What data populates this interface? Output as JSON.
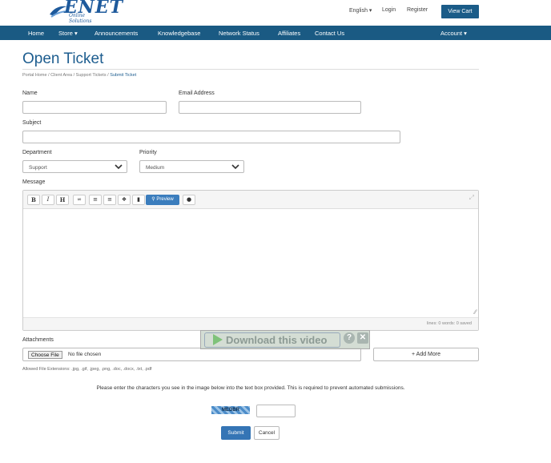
{
  "header": {
    "logo_text": "ENET",
    "logo_tagline": "Online Solutions",
    "language": "English ▾",
    "login": "Login",
    "register": "Register",
    "view_cart": "View Cart"
  },
  "nav": {
    "items": [
      {
        "label": "Home"
      },
      {
        "label": "Store ▾"
      },
      {
        "label": "Announcements"
      },
      {
        "label": "Knowledgebase"
      },
      {
        "label": "Network Status"
      },
      {
        "label": "Affiliates"
      },
      {
        "label": "Contact Us"
      }
    ],
    "account": "Account ▾"
  },
  "page": {
    "title": "Open Ticket",
    "breadcrumb": [
      "Portal Home",
      "Client Area",
      "Support Tickets",
      "Submit Ticket"
    ]
  },
  "form": {
    "name_label": "Name",
    "email_label": "Email Address",
    "subject_label": "Subject",
    "department_label": "Department",
    "department_value": "Support",
    "priority_label": "Priority",
    "priority_value": "Medium",
    "message_label": "Message",
    "preview_label": "Preview",
    "editor_status": "lines: 0   words: 0   saved",
    "attachments_label": "Attachments",
    "choose_file": "Choose File",
    "no_file": "No file chosen",
    "add_more": "+ Add More",
    "allowed": "Allowed File Extensions: .jpg, .gif, .jpeg, .png, .doc, .docx, .txt, .pdf",
    "captcha_note": "Please enter the characters you see in the image below into the text box provided. This is required to prevent automated submissions.",
    "captcha_code": "MEDBR",
    "submit": "Submit",
    "cancel": "Cancel"
  },
  "overlay": {
    "text": "Download this video"
  },
  "colors": {
    "nav_bg": "#1a5a83",
    "title": "#1d5d8f",
    "primary_button": "#3575b5"
  }
}
